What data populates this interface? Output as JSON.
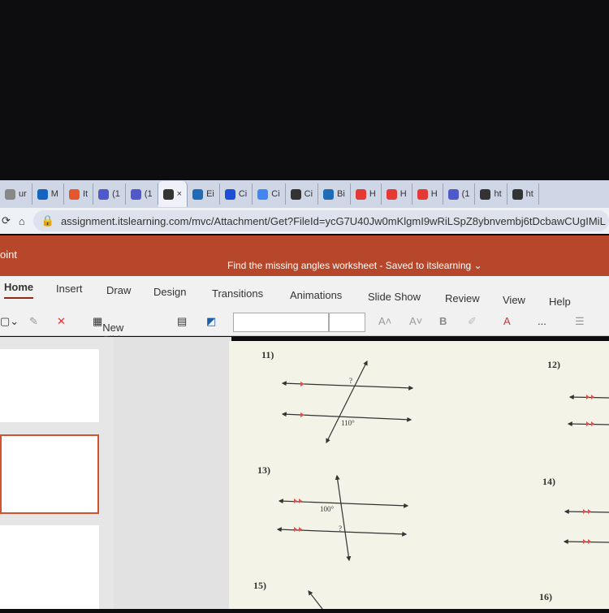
{
  "browser": {
    "tabs": [
      {
        "label": "ur",
        "icon": "generic-icon",
        "color": "#888"
      },
      {
        "label": "M",
        "icon": "outlook-icon",
        "color": "#1565c0"
      },
      {
        "label": "It",
        "icon": "itslearning-icon",
        "color": "#e4572e"
      },
      {
        "label": "(1",
        "icon": "teams-icon",
        "color": "#5059c9"
      },
      {
        "label": "(1",
        "icon": "teams-icon",
        "color": "#5059c9"
      },
      {
        "label": "×",
        "icon": "globe-icon",
        "color": "#333",
        "active": true
      },
      {
        "label": "Ei",
        "icon": "edge-icon",
        "color": "#1e6bb8"
      },
      {
        "label": "Ci",
        "icon": "quizlet-icon",
        "color": "#1d4ed8"
      },
      {
        "label": "Ci",
        "icon": "google-icon",
        "color": "#4285f4"
      },
      {
        "label": "Ci",
        "icon": "dots-icon",
        "color": "#333"
      },
      {
        "label": "Bi",
        "icon": "edge-icon",
        "color": "#1e6bb8"
      },
      {
        "label": "H",
        "icon": "youtube-icon",
        "color": "#e53935"
      },
      {
        "label": "H",
        "icon": "youtube-icon",
        "color": "#e53935"
      },
      {
        "label": "H",
        "icon": "youtube-icon",
        "color": "#e53935"
      },
      {
        "label": "(1",
        "icon": "teams-icon",
        "color": "#5059c9"
      },
      {
        "label": "ht",
        "icon": "globe-icon",
        "color": "#333"
      },
      {
        "label": "ht",
        "icon": "globe-icon",
        "color": "#333"
      }
    ],
    "url": "assignment.itslearning.com/mvc/Attachment/Get?FileId=ycG7U40Jw0mKlgmI9wRiLSpZ8ybnvembj6tDcbawCUgIMiL"
  },
  "app": {
    "name": "oint",
    "doc_title": "Find the missing angles worksheet",
    "save_status": "Saved to itslearning",
    "accent": "#b7472a"
  },
  "ribbon": {
    "tabs": [
      "Home",
      "Insert",
      "Draw",
      "Design",
      "Transitions",
      "Animations",
      "Slide Show",
      "Review",
      "View",
      "Help"
    ],
    "active": "Home",
    "new_slide": "New Slide",
    "bold": "B",
    "more": "..."
  },
  "slide": {
    "problems": [
      {
        "num": "11)",
        "top_label": "?",
        "bottom_label": "110°"
      },
      {
        "num": "12)"
      },
      {
        "num": "13)",
        "top_label": "100°",
        "bottom_label": "?"
      },
      {
        "num": "14)"
      },
      {
        "num": "15)"
      },
      {
        "num": "16)"
      }
    ]
  }
}
